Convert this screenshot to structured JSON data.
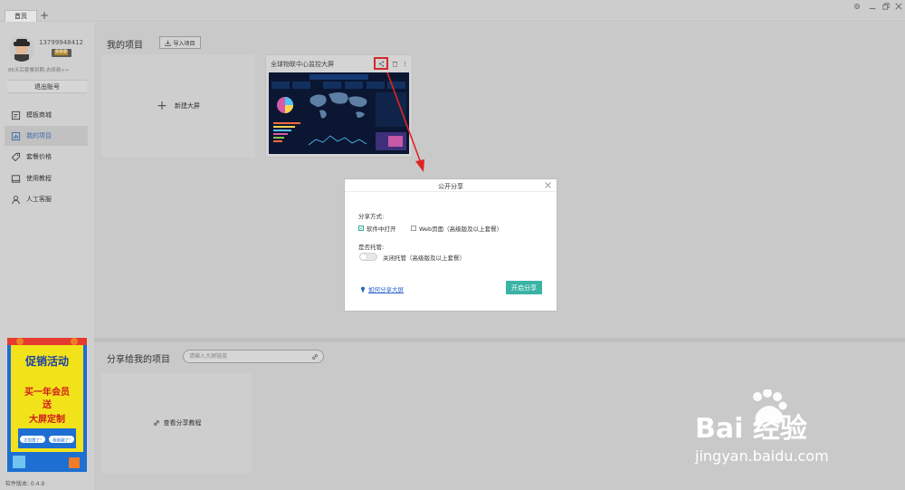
{
  "tabs": {
    "home": "首页",
    "add": "+"
  },
  "user": {
    "phone": "13799948412",
    "vip_badge": "高级版",
    "vip_note": "86天后套餐到期,去续费>>",
    "logout": "退出账号"
  },
  "nav": [
    {
      "label": "模板商城",
      "icon": "template-store-icon"
    },
    {
      "label": "我的项目",
      "icon": "bar-chart-icon"
    },
    {
      "label": "套餐价格",
      "icon": "price-tag-icon"
    },
    {
      "label": "使用教程",
      "icon": "book-icon"
    },
    {
      "label": "人工客服",
      "icon": "user-icon"
    }
  ],
  "promo": {
    "title": "促销活动",
    "line1": "买一年会员",
    "line2": "送",
    "line3": "大屏定制",
    "btn_left": "太划算了!",
    "btn_right": "我被戳了!"
  },
  "version": "软件版本: 0.4.9",
  "main": {
    "my_projects_title": "我的项目",
    "import_label": "导入项目",
    "new_screen_label": "新建大屏",
    "project_title": "全球物联中心监控大屏",
    "shared_title": "分享给我的项目",
    "shared_search_placeholder": "请输入大屏链接",
    "tutorial_label": "查看分享教程"
  },
  "dialog": {
    "title": "公开分享",
    "share_method_label": "分享方式:",
    "option_software": "软件中打开",
    "option_web": "Web页面（高级版及以上套餐）",
    "hosting_label": "是否托管:",
    "hosting_option": "关闭托管（高级版及以上套餐）",
    "help_link": "如何分享大屏",
    "start_button": "开启分享",
    "software_checked": true,
    "web_checked": false,
    "hosting_on": false
  },
  "watermark": {
    "brand": "Bai 经验",
    "url": "jingyan.baidu.com"
  },
  "colors": {
    "accent": "#3ab3a5",
    "highlight": "#d52929",
    "link": "#2a62c9"
  }
}
